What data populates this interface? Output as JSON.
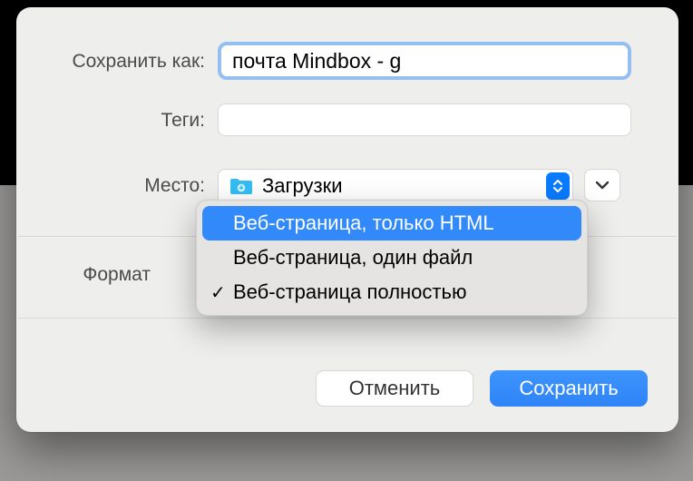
{
  "labels": {
    "save_as": "Сохранить как:",
    "tags": "Теги:",
    "where": "Место:",
    "format": "Формат"
  },
  "filename": "почта Mindbox - g",
  "tags_value": "",
  "where": {
    "folder_name": "Загрузки"
  },
  "format_options": [
    {
      "label": "Веб-страница, только HTML",
      "highlighted": true,
      "checked": false
    },
    {
      "label": "Веб-страница, один файл",
      "highlighted": false,
      "checked": false
    },
    {
      "label": "Веб-страница полностью",
      "highlighted": false,
      "checked": true
    }
  ],
  "buttons": {
    "cancel": "Отменить",
    "save": "Сохранить"
  },
  "colors": {
    "accent": "#328afa"
  }
}
